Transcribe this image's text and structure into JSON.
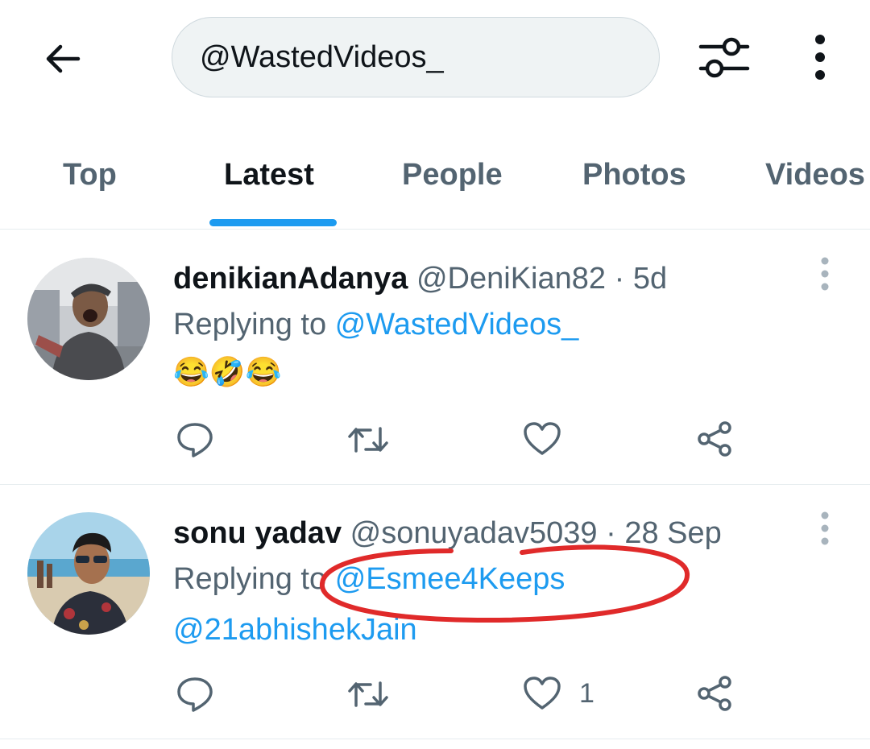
{
  "search": {
    "query": "@WastedVideos_"
  },
  "tabs": [
    {
      "label": "Top"
    },
    {
      "label": "Latest"
    },
    {
      "label": "People"
    },
    {
      "label": "Photos"
    },
    {
      "label": "Videos"
    }
  ],
  "active_tab": "Latest",
  "tweets": [
    {
      "name": "denikianAdanya",
      "handle": "@DeniKian82",
      "separator": "·",
      "time": "5d",
      "reply_prefix": "Replying to",
      "reply_to": "@WastedVideos_",
      "body_emoji": "😂🤣😂",
      "like_count": ""
    },
    {
      "name": "sonu yadav",
      "handle": "@sonuyadav5039",
      "separator": "·",
      "time": "28 Sep",
      "reply_prefix": "Replying to",
      "reply_to": "@Esmee4Keeps",
      "reply_to_second": "@21abhishekJain",
      "like_count": "1"
    }
  ],
  "colors": {
    "accent": "#1d9bf0",
    "secondary_text": "#536471",
    "annotation": "#e02a2a"
  },
  "icons": [
    "back-arrow-icon",
    "filter-sliders-icon",
    "more-vertical-icon",
    "caret-more-icon",
    "reply-icon",
    "retweet-icon",
    "like-icon",
    "share-icon"
  ]
}
